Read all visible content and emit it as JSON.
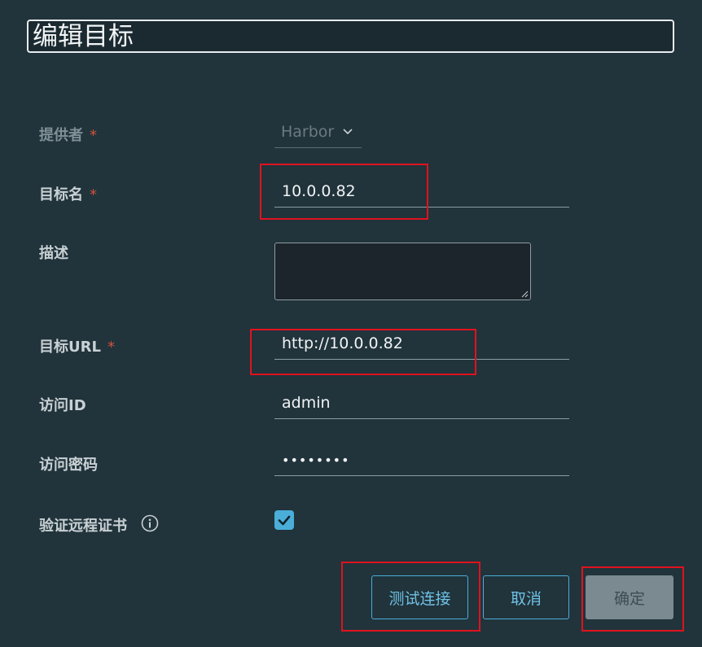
{
  "dialog": {
    "title": "编辑目标"
  },
  "form": {
    "provider": {
      "label": "提供者",
      "required_mark": "*",
      "value": "Harbor"
    },
    "target_name": {
      "label": "目标名",
      "required_mark": "*",
      "value": "10.0.0.82"
    },
    "description": {
      "label": "描述",
      "value": ""
    },
    "target_url": {
      "label": "目标URL",
      "required_mark": "*",
      "value": "http://10.0.0.82"
    },
    "access_id": {
      "label": "访问ID",
      "value": "admin"
    },
    "access_secret": {
      "label": "访问密码",
      "value": "••••••••"
    },
    "verify_cert": {
      "label": "验证远程证书",
      "checked": true
    }
  },
  "buttons": {
    "test_connection": "测试连接",
    "cancel": "取消",
    "ok": "确定"
  },
  "icons": {
    "provider_dropdown": "chevron-down-icon",
    "verify_cert_info": "info-icon",
    "checkbox": "check-icon"
  },
  "colors": {
    "background": "#21333b",
    "accent": "#4aaed9",
    "required": "#d0533c",
    "highlight": "#e0121f"
  }
}
